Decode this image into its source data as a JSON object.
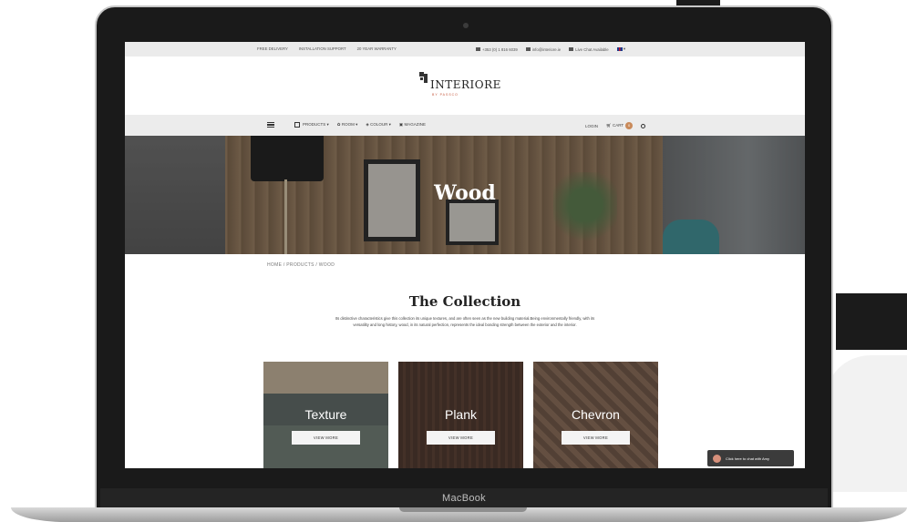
{
  "topbar": {
    "free_delivery": "FREE DELIVERY",
    "installation_support": "INSTALLATION SUPPORT",
    "warranty": "20 YEAR WARRANTY",
    "phone": "+353 (0) 1 816 6039",
    "email": "info@interiore.ie",
    "live_chat": "Live Chat Available"
  },
  "logo": {
    "name": "INTERIORE",
    "sub": "BY PASSCO"
  },
  "nav": {
    "products": "PRODUCTS",
    "room": "ROOM",
    "colour": "COLOUR",
    "magazine": "MAGAZINE",
    "login": "LOGIN",
    "cart": "CART",
    "cart_count": "0"
  },
  "hero": {
    "title": "Wood"
  },
  "breadcrumb": "HOME  /  PRODUCTS  /  WOOD",
  "collection": {
    "title": "The Collection",
    "description": "Its distinctive characteristics give this collection its unique textures, and are often seen as the new building material.Being environmentally friendly, with its versatility and long history, wood, in its natural perfection, represents the ideal bonding strength between the exterior and the interior."
  },
  "cards": [
    {
      "label": "Texture",
      "button": "VIEW MORE"
    },
    {
      "label": "Plank",
      "button": "VIEW MORE"
    },
    {
      "label": "Chevron",
      "button": "VIEW MORE"
    }
  ],
  "chat": {
    "label": "Click here to chat with Amy"
  },
  "device": {
    "label": "MacBook"
  }
}
